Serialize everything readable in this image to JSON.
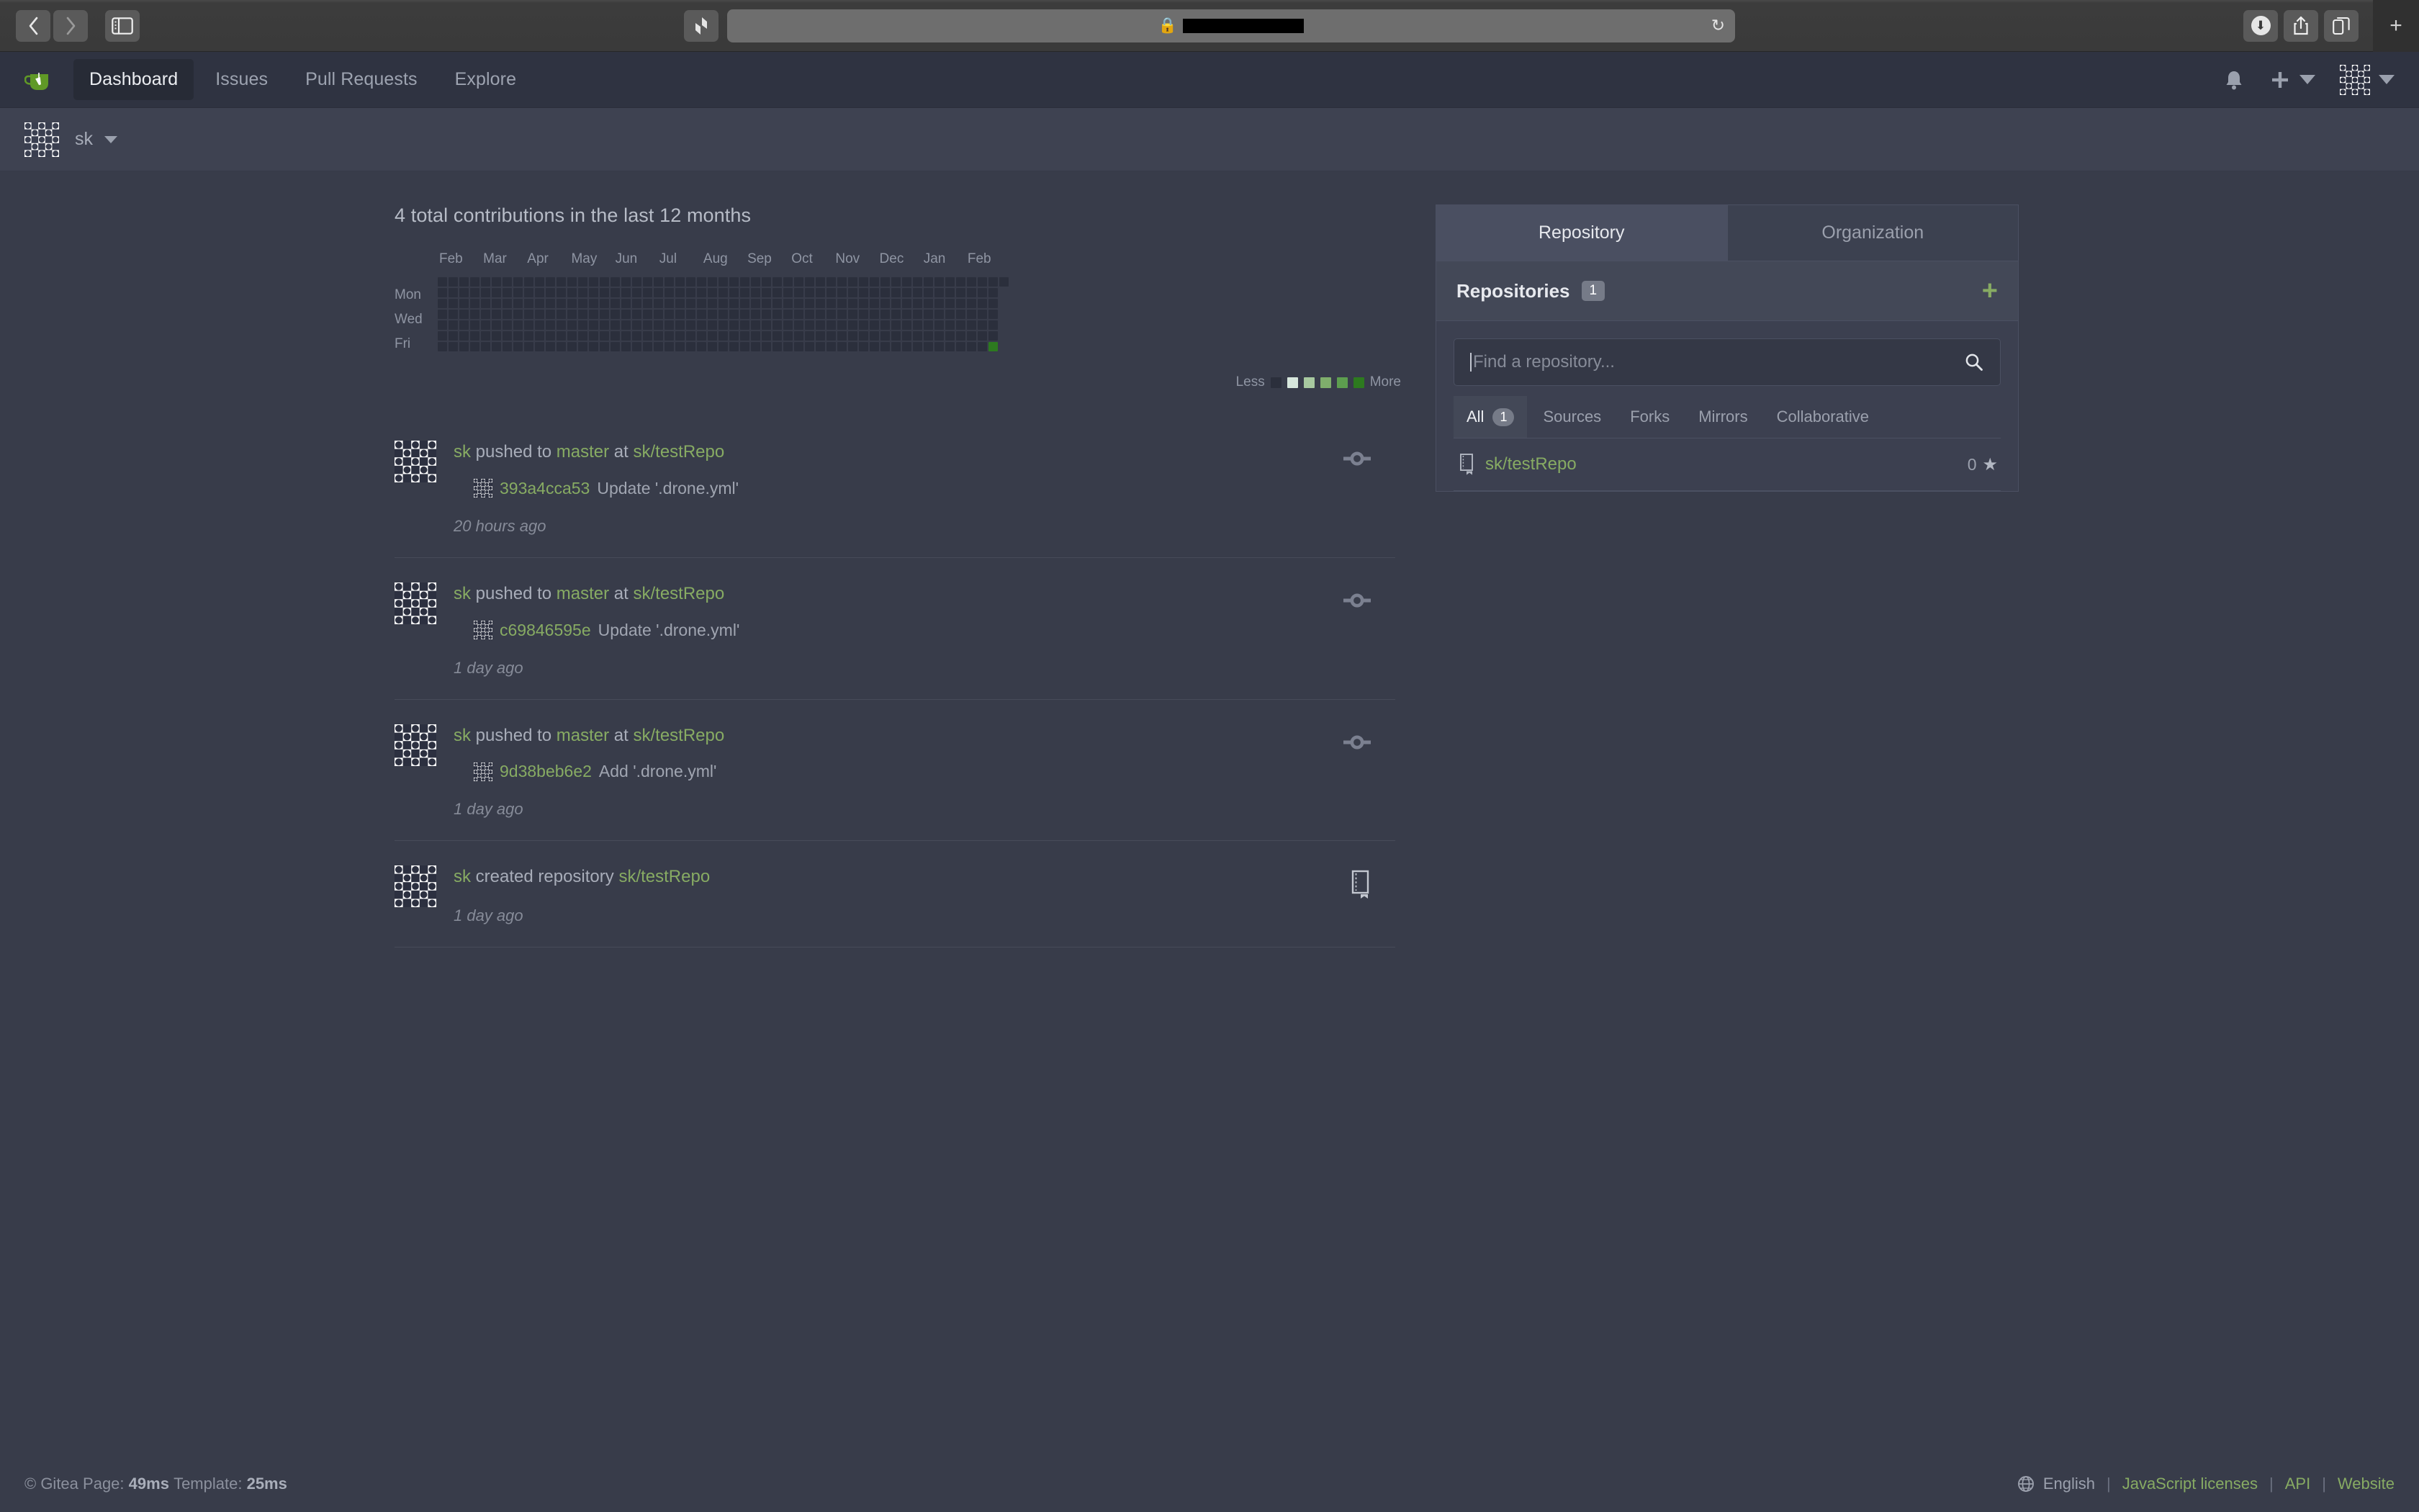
{
  "browser": {
    "back_icon": "chevron-left-icon",
    "forward_icon": "chevron-right-icon",
    "sidebar_icon": "sidebar-toggle-icon",
    "extension_icon": "extension-icon",
    "lock_icon": "lock-icon",
    "url": "",
    "reload_icon": "reload-icon",
    "downloads_icon": "downloads-icon",
    "share_icon": "share-icon",
    "tabs_icon": "tab-overview-icon",
    "newtab_label": "+"
  },
  "navbar": {
    "logo": "gitea-logo",
    "items": [
      {
        "label": "Dashboard",
        "active": true
      },
      {
        "label": "Issues",
        "active": false
      },
      {
        "label": "Pull Requests",
        "active": false
      },
      {
        "label": "Explore",
        "active": false
      }
    ],
    "bell_icon": "bell-icon",
    "plus_icon": "plus-icon",
    "avatar": "user-avatar-identicon"
  },
  "context": {
    "avatar": "context-avatar-identicon",
    "name": "sk",
    "caret": "chevron-down-icon"
  },
  "contributions": {
    "title": "4 total contributions in the last 12 months",
    "legend_less": "Less",
    "legend_more": "More"
  },
  "chart_data": {
    "type": "heatmap",
    "title": "4 total contributions in the last 12 months",
    "total_contributions": 4,
    "period": "last 12 months",
    "month_labels": [
      "Feb",
      "Mar",
      "Apr",
      "May",
      "Jun",
      "Jul",
      "Aug",
      "Sep",
      "Oct",
      "Nov",
      "Dec",
      "Jan",
      "Feb"
    ],
    "day_labels": [
      "",
      "Mon",
      "",
      "Wed",
      "",
      "Fri",
      ""
    ],
    "weeks": 53,
    "days_per_week": 7,
    "levels": [
      0,
      1,
      2,
      3,
      4
    ],
    "level_colors": [
      "#2b2f3c",
      "#d6e685",
      "#8cc665",
      "#44a340",
      "#2d7a1f"
    ],
    "legend_colors": [
      "#2b2f3c",
      "#d7e7dd",
      "#a8c9a0",
      "#7fae6c",
      "#5d9e4f",
      "#2d7a1f"
    ],
    "active_cells": [
      {
        "week": 51,
        "day": 6,
        "level": 4,
        "count": 4
      }
    ],
    "last_week_partial_days": 1
  },
  "feed": [
    {
      "avatar": "user-avatar-identicon",
      "actor": "sk",
      "action": "pushed to",
      "branch": "master",
      "at": "at",
      "repo": "sk/testRepo",
      "commit_avatar": "commit-author-identicon",
      "sha": "393a4cca53",
      "message": "Update '.drone.yml'",
      "time": "20 hours ago",
      "octicon": "git-commit-icon"
    },
    {
      "avatar": "user-avatar-identicon",
      "actor": "sk",
      "action": "pushed to",
      "branch": "master",
      "at": "at",
      "repo": "sk/testRepo",
      "commit_avatar": "commit-author-identicon",
      "sha": "c69846595e",
      "message": "Update '.drone.yml'",
      "time": "1 day ago",
      "octicon": "git-commit-icon"
    },
    {
      "avatar": "user-avatar-identicon",
      "actor": "sk",
      "action": "pushed to",
      "branch": "master",
      "at": "at",
      "repo": "sk/testRepo",
      "commit_avatar": "commit-author-identicon",
      "sha": "9d38beb6e2",
      "message": "Add '.drone.yml'",
      "time": "1 day ago",
      "octicon": "git-commit-icon"
    },
    {
      "avatar": "user-avatar-identicon",
      "actor": "sk",
      "action": "created repository",
      "branch": "",
      "at": "",
      "repo": "sk/testRepo",
      "commit_avatar": "",
      "sha": "",
      "message": "",
      "time": "1 day ago",
      "octicon": "repo-icon"
    }
  ],
  "sidebar": {
    "tabs": [
      {
        "label": "Repository",
        "active": true
      },
      {
        "label": "Organization",
        "active": false
      }
    ],
    "panel_title": "Repositories",
    "panel_count": "1",
    "add_icon": "plus-icon",
    "search_placeholder": "Find a repository...",
    "search_value": "",
    "search_icon": "search-icon",
    "filters": [
      {
        "label": "All",
        "count": "1",
        "active": true
      },
      {
        "label": "Sources",
        "count": "",
        "active": false
      },
      {
        "label": "Forks",
        "count": "",
        "active": false
      },
      {
        "label": "Mirrors",
        "count": "",
        "active": false
      },
      {
        "label": "Collaborative",
        "count": "",
        "active": false
      }
    ],
    "repos": [
      {
        "icon": "repo-icon",
        "name": "sk/testRepo",
        "stars": "0",
        "star_icon": "star-icon"
      }
    ]
  },
  "footer": {
    "copyright": "© Gitea",
    "page_label": "Page:",
    "page_time": "49ms",
    "template_label": "Template:",
    "template_time": "25ms",
    "globe_icon": "globe-icon",
    "language": "English",
    "links": [
      "JavaScript licenses",
      "API",
      "Website"
    ]
  }
}
